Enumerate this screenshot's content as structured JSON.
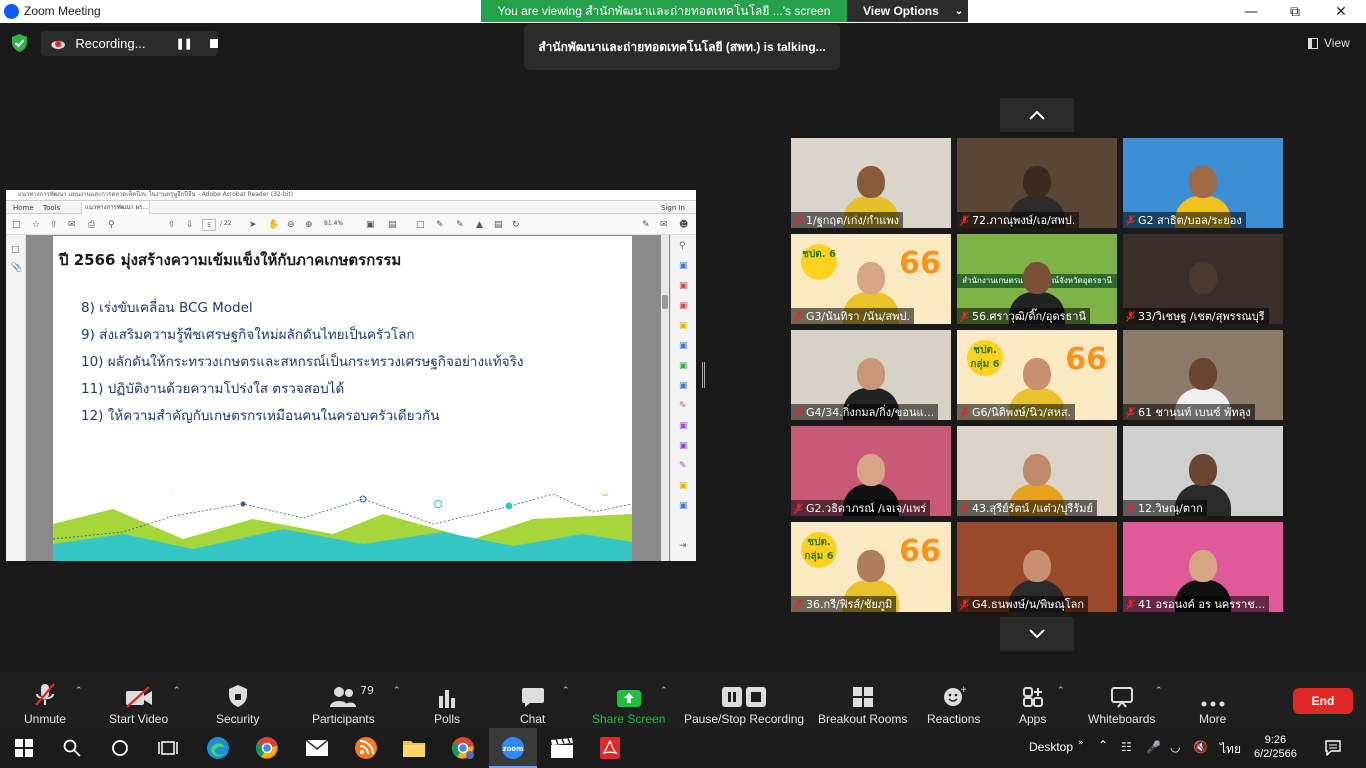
{
  "window": {
    "title": "Zoom Meeting",
    "viewing_banner": "You are viewing สำนักพัฒนาและถ่ายทอดเทคโนโลยี ...'s screen",
    "view_options": "View Options"
  },
  "meeting": {
    "recording_label": "Recording...",
    "talking": "สำนักพัฒนาและถ่ายทอดเทคโนโลยี (สพท.) is  talking...",
    "view_label": "View"
  },
  "acrobat": {
    "title": "แนวทางการพัฒนา แผนงานและการตลาดเห็ดปีงบ ในงานตรุษูจีกปีจีน - Adobe Acrobat Reader (32-bit)",
    "menu_home": "Home",
    "menu_tools": "Tools",
    "tab": "แนวทางการพัฒนา ผร...",
    "sign_in": "Sign In",
    "page_current": "5",
    "page_total": "/ 22",
    "zoom": "81.4%"
  },
  "slide": {
    "title": "ปี 2566 มุ่งสร้างความเข้มแข็งให้กับภาคเกษตรกรรม",
    "items": [
      "8) เร่งขับเคลื่อน BCG Model",
      "9) ส่งเสริมความรู้พืชเศรษฐกิจใหม่ผลักดันไทยเป็นครัวโลก",
      "10) ผลักดันให้กระทรวงเกษตรและสหกรณ์เป็นกระทรวงเศรษฐกิจอย่างแท้จริง",
      "11) ปฏิบัติงานด้วยความโปร่งใส ตรวจสอบได้",
      "12) ให้ความสำคัญกับเกษตรกรเหมือนคนในครอบครัวเดียวกัน"
    ]
  },
  "participants_tiles": [
    {
      "name": "1/ฐกฤต/เก่ง/กำแพง",
      "bg": "#d9d4cc",
      "skin": "#8a5a3c",
      "shirt": "#e7c12a"
    },
    {
      "name": "72.ภาณุพงษ์/เอ/สพป.",
      "bg": "#5a4635",
      "skin": "#3a2a20",
      "shirt": "#2b2b2b"
    },
    {
      "name": "G2 สาธิต/บอล/ระยอง",
      "bg": "#3c8fd4",
      "skin": "#a06a45",
      "shirt": "#f0c21e"
    },
    {
      "name": "G3/นันทิรา /นัน/สพป.",
      "bg": "#fbe9c4",
      "skin": "#d8a486",
      "shirt": "#e9c32c"
    },
    {
      "name": "56.ศราวุฒิ/ดิ๊ก/อุดรธานี",
      "bg": "#7db347",
      "skin": "#7a5036",
      "shirt": "#222222"
    },
    {
      "name": "33/วิเชษฐ /เชต/สุพรรณบุรี",
      "bg": "#3b2e2a",
      "skin": "#4a3a30",
      "shirt": "#3b2e2a"
    },
    {
      "name": "G4/34.กิ่งกมล/กิ่ง/ขอนแ...",
      "bg": "#d7d2c6",
      "skin": "#c89678",
      "shirt": "#222222"
    },
    {
      "name": "G6/นิติพงษ์/นิว/สหส.",
      "bg": "#fbe9c4",
      "skin": "#c89070",
      "shirt": "#e9c32c"
    },
    {
      "name": "61 ชานนท์ เบนซ์ พัทลุง",
      "bg": "#8c7b68",
      "skin": "#6a4530",
      "shirt": "#efefef"
    },
    {
      "name": "G2.วธิดาภรณ์ /เจเจ/แพร่",
      "bg": "#c85a78",
      "skin": "#d8a486",
      "shirt": "#111111"
    },
    {
      "name": "43.สุรีย์รัตน์ /แต๋ว/บุรีรัมย์",
      "bg": "#dcd4c8",
      "skin": "#c08a6a",
      "shirt": "#e8a21e"
    },
    {
      "name": "12.วิษณุ/ตาก",
      "bg": "#cfcfcf",
      "skin": "#6a4530",
      "shirt": "#2a2a2a"
    },
    {
      "name": "36.กรี/ฟิรส์/ชัยภูมิ",
      "bg": "#fbe9c4",
      "skin": "#b07d5c",
      "shirt": "#e9c32c"
    },
    {
      "name": "G4.ธนพงษ์/น/พิษณุโลก",
      "bg": "#9a4a2a",
      "skin": "#c89070",
      "shirt": "#2a2a2a"
    },
    {
      "name": "41 อรอนงค์ อร นครราช...",
      "bg": "#e05a9a",
      "skin": "#d8a486",
      "shirt": "#111111"
    }
  ],
  "badges": {
    "num66": "66",
    "group_badge": "ชปต. กลุ่ม 6",
    "group_badge_short": "ชปต. 6",
    "banner_text": "สำนักงานเกษตรและสหกรณ์จังหวัดอุดรธานี"
  },
  "toolbar": {
    "unmute": "Unmute",
    "start_video": "Start Video",
    "security": "Security",
    "participants": "Participants",
    "participants_count": "79",
    "polls": "Polls",
    "chat": "Chat",
    "share_screen": "Share Screen",
    "pause_stop_recording": "Pause/Stop Recording",
    "breakout_rooms": "Breakout Rooms",
    "reactions": "Reactions",
    "apps": "Apps",
    "whiteboards": "Whiteboards",
    "more": "More",
    "end": "End"
  },
  "taskbar": {
    "desktop": "Desktop",
    "lang": "ไทย",
    "time": "9:26",
    "date": "6/2/2566"
  },
  "colors": {
    "zoom_blue": "#0b5cff",
    "green_banner": "#24a14a",
    "end_red": "#e02828",
    "share_green": "#1fbf3f"
  }
}
